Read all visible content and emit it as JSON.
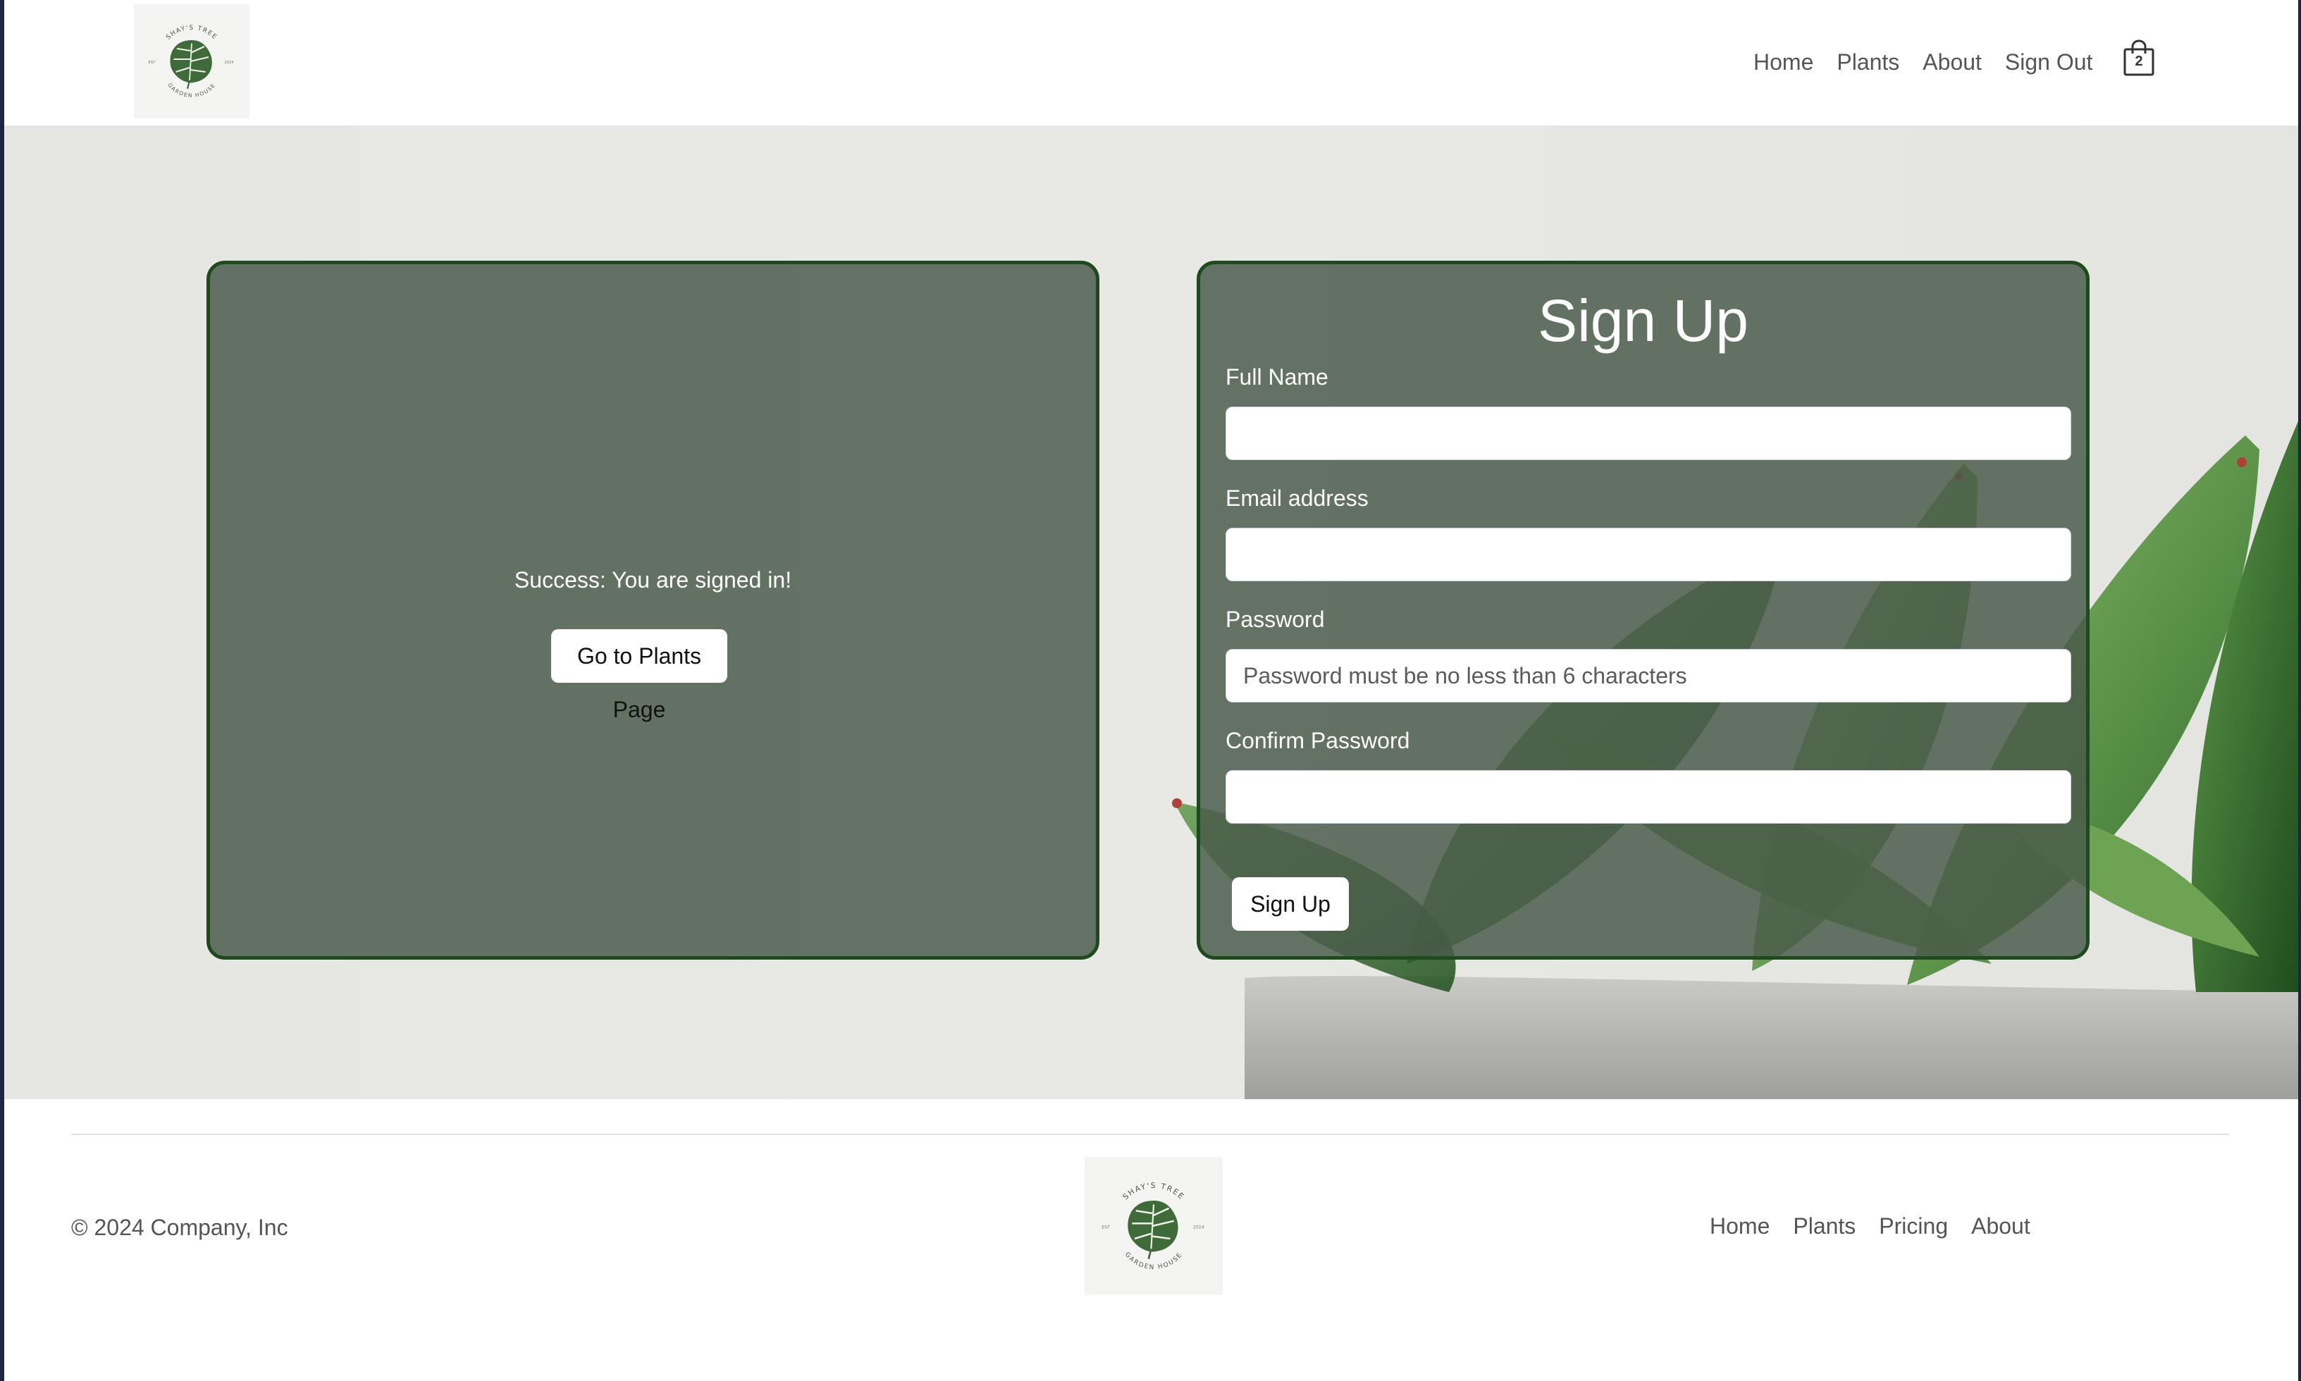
{
  "brand": {
    "logo_text_top": "SHAY'S TREE",
    "logo_text_bottom": "GARDEN HOUSE",
    "logo_left": "EST",
    "logo_right": "2024"
  },
  "header": {
    "nav": [
      "Home",
      "Plants",
      "About",
      "Sign Out"
    ],
    "cart_count": "2"
  },
  "left_panel": {
    "message": "Success: You are signed in!",
    "button_label": "Go to Plants Page"
  },
  "signup_form": {
    "title": "Sign Up",
    "fields": [
      {
        "label": "Full Name",
        "value": "",
        "placeholder": ""
      },
      {
        "label": "Email address",
        "value": "",
        "placeholder": ""
      },
      {
        "label": "Password",
        "value": "",
        "placeholder": "Password must be no less than 6 characters"
      },
      {
        "label": "Confirm Password",
        "value": "",
        "placeholder": ""
      }
    ],
    "submit_label": "Sign Up"
  },
  "footer": {
    "copyright": "© 2024 Company, Inc",
    "nav": [
      "Home",
      "Plants",
      "Pricing",
      "About"
    ]
  },
  "colors": {
    "panel_bg": "#4a5a4a",
    "panel_border": "#1e4a1e",
    "hero_bg": "#e6e6e2",
    "nav_text": "#555555"
  }
}
